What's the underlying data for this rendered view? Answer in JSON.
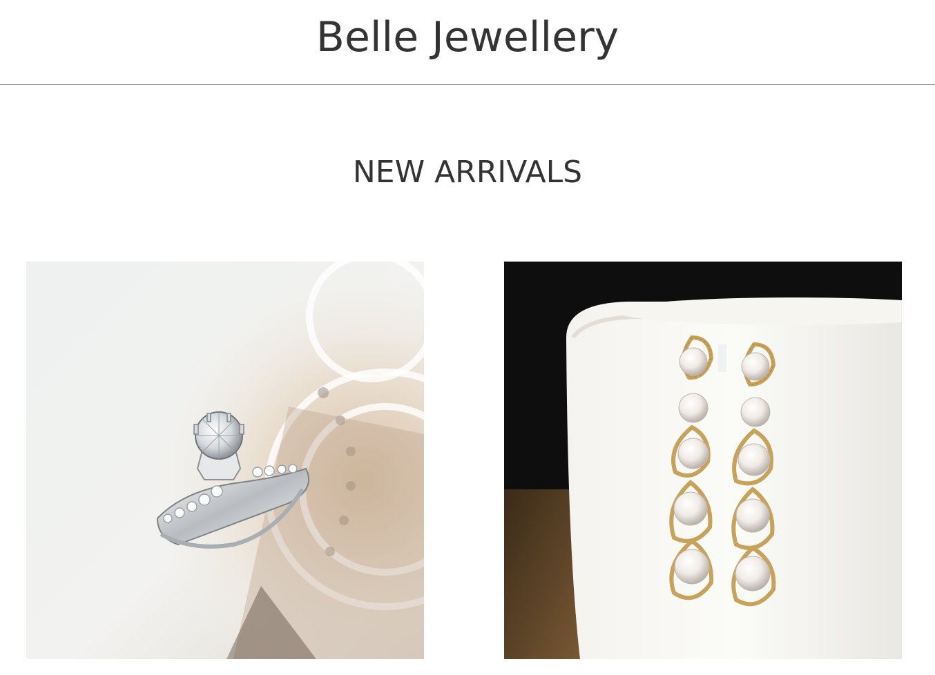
{
  "header": {
    "brand_name": "Belle Jewellery"
  },
  "new_arrivals": {
    "title": "NEW ARRIVALS",
    "products": [
      {
        "icon": "diamond-ring-photo",
        "background_color": "#e8ece9"
      },
      {
        "icon": "pearl-earrings-photo",
        "background_color": "#111111"
      }
    ]
  },
  "colors": {
    "text": "#333333",
    "divider": "#9a9a9a",
    "background": "#ffffff"
  }
}
